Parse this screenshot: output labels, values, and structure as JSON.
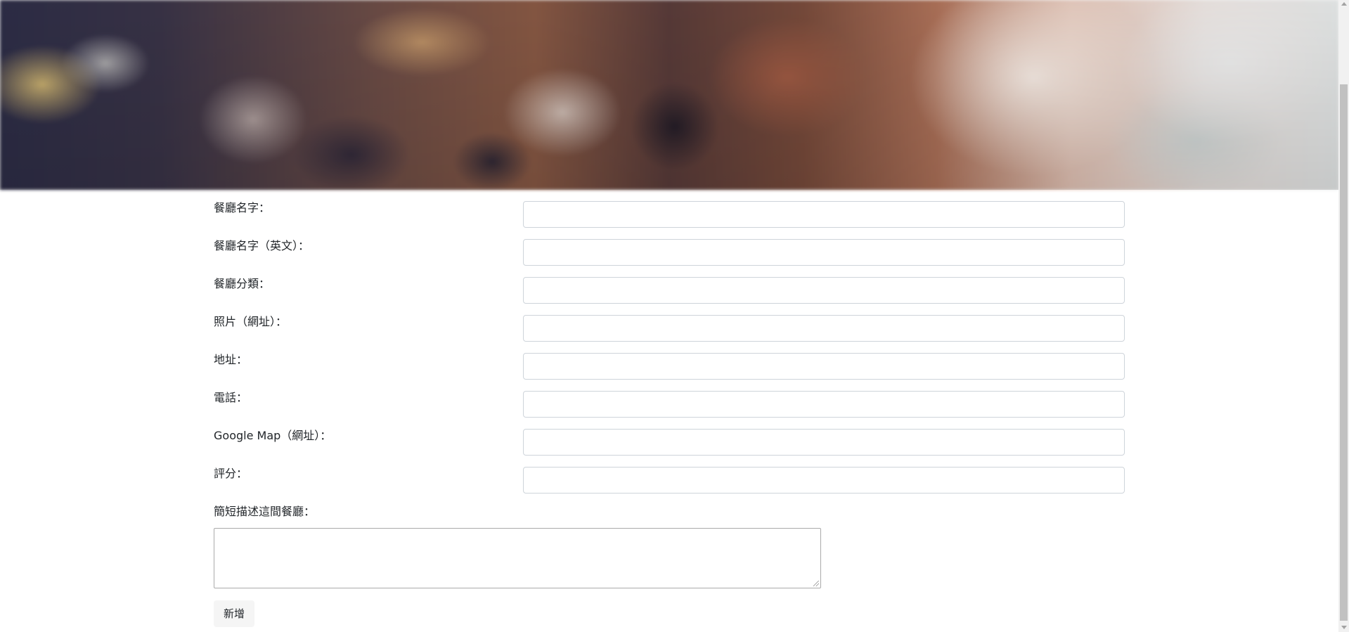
{
  "hero": {
    "image_alt": "restaurant interior (blurred)"
  },
  "form": {
    "fields": [
      {
        "label": "餐廳名字：",
        "value": "",
        "placeholder": ""
      },
      {
        "label": "餐廳名字（英文）：",
        "value": "",
        "placeholder": ""
      },
      {
        "label": "餐廳分類：",
        "value": "",
        "placeholder": ""
      },
      {
        "label": "照片（網址）：",
        "value": "",
        "placeholder": ""
      },
      {
        "label": "地址：",
        "value": "",
        "placeholder": ""
      },
      {
        "label": "電話：",
        "value": "",
        "placeholder": ""
      },
      {
        "label": "Google Map（網址）：",
        "value": "",
        "placeholder": ""
      },
      {
        "label": "評分：",
        "value": "",
        "placeholder": ""
      }
    ],
    "description": {
      "label": "簡短描述這間餐廳：",
      "value": ""
    },
    "submit_label": "新增"
  },
  "colors": {
    "input_border": "#ced4da",
    "button_bg": "#f5f5f5",
    "text": "#212529"
  }
}
